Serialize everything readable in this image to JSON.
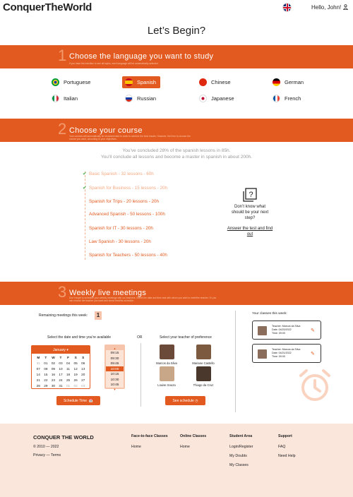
{
  "header": {
    "logo": "ConquerTheWorld",
    "greeting": "Hello, John!"
  },
  "title": "Let’s Begin?",
  "languages_section": {
    "number": "1",
    "title": "Choose the language you want to study",
    "subtitle": "If you have the intention to see all topics, each language will be automatically selected",
    "languages": [
      "Portuguese",
      "Spanish",
      "Chinese",
      "German",
      "Italian",
      "Russian",
      "Japanese",
      "French"
    ],
    "selected": "Spanish"
  },
  "course_section": {
    "number": "2",
    "title": "Choose your course",
    "subtitle": "Your courses will automatically be recommended in order to achieve the best results. However, feel free to choose the course you want, according to your objectives.",
    "stat1": "You’ve concluded 28% of the spanish lessons in 85h.",
    "stat2": "You’ll conclude all lessons and become a master in spanish in about 200h.",
    "courses": [
      "Basic Spanish - 32 lessons - 60h",
      "Spanish for Business - 15 lessons - 20h",
      "Spanish for Trips - 20 lessons - 20h",
      "Advanced Spanish - 50 lessons - 100h",
      "Spanish for IT - 30 lessons - 20h",
      "Law Spanish - 30 lessons - 20h",
      "Spanish for Teachers - 50 lessons - 40h"
    ],
    "help_question": "Don’t know what should be your next step?",
    "help_link": "Answer the test and find out"
  },
  "meetings_section": {
    "number": "3",
    "title": "Weekly live meetings",
    "subtitle": "Don’t forget to schedule your weekly meetings with our teachers. Select the date and time and with whom you wish to meet/the teacher. Or you can choose the teacher you want and check their/his schedule.",
    "remaining_label": "Remaining meetings this week:",
    "remaining_count": "1",
    "date_label": "Select the date and time you’re available",
    "or_label": "OR",
    "teacher_label": "Select your teacher of preference",
    "month": "January",
    "weekdays": [
      "M",
      "T",
      "W",
      "T",
      "F",
      "S",
      "S"
    ],
    "days": [
      "31",
      "01",
      "02",
      "03",
      "04",
      "05",
      "06",
      "07",
      "08",
      "09",
      "10",
      "11",
      "12",
      "13",
      "14",
      "15",
      "16",
      "17",
      "18",
      "19",
      "20",
      "21",
      "22",
      "23",
      "24",
      "25",
      "26",
      "27",
      "28",
      "29",
      "30",
      "31",
      "01",
      "02",
      "03"
    ],
    "times": [
      "09:15",
      "09:30",
      "09:45",
      "10:00",
      "10:15",
      "10:30",
      "10:45"
    ],
    "selected_time": "10:00",
    "schedule_button": "Schedule Time",
    "see_schedule_button": "See schedule",
    "teachers": [
      "Marcos da Silva",
      "Mariane Castello",
      "Louise Souza",
      "Thiago da Cruz"
    ],
    "classes_label": "Your classes this week:",
    "classes": [
      {
        "teacher": "Teacher: Marcos da Silva",
        "date": "Date: 04/20/2022",
        "time": "Time: 09:00"
      },
      {
        "teacher": "Teacher: Marcos da Silva",
        "date": "Date: 04/21/2022",
        "time": "Time: 09:00"
      }
    ]
  },
  "footer": {
    "brand": "CONQUER THE WORLD",
    "copyright": "© 2010 — 2022",
    "privacy": "Privacy — Terms",
    "cols": [
      {
        "title": "Face-to-face Classes",
        "links": [
          "Home"
        ]
      },
      {
        "title": "Online Classes",
        "links": [
          "Home"
        ]
      },
      {
        "title": "Student Area",
        "links": [
          "Login/Register",
          "My Doubts",
          "My Classes"
        ]
      },
      {
        "title": "Support",
        "links": [
          "FAQ",
          "Need Help"
        ]
      }
    ]
  }
}
